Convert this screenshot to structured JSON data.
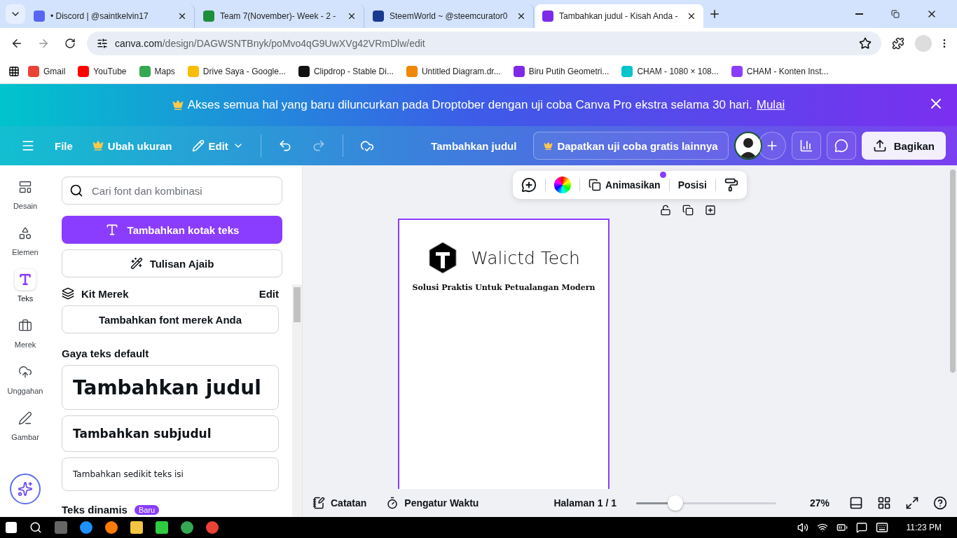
{
  "browser": {
    "tabs": [
      {
        "title": "• Discord | @saintkelvin17",
        "selected": false,
        "color": "#5865f2"
      },
      {
        "title": "Team 7(November)- Week - 2 -",
        "selected": false,
        "color": "#1e8e3e"
      },
      {
        "title": "SteemWorld ~ @steemcurator0",
        "selected": false,
        "color": "#1a3a8f"
      },
      {
        "title": "Tambahkan judul - Kisah Anda -",
        "selected": true,
        "color": "#7d2ae8"
      }
    ],
    "url_host": "canva.com",
    "url_path": "/design/DAGWSNTBnyk/poMvo4qG9UwXVg42VRmDlw/edit",
    "bookmarks": [
      {
        "label": "Gmail",
        "color": "#ea4335"
      },
      {
        "label": "YouTube",
        "color": "#ff0000"
      },
      {
        "label": "Maps",
        "color": "#34a853"
      },
      {
        "label": "Drive Saya - Google...",
        "color": "#fbbc04"
      },
      {
        "label": "Clipdrop - Stable Di...",
        "color": "#111111"
      },
      {
        "label": "Untitled Diagram.dr...",
        "color": "#f08705"
      },
      {
        "label": "Biru Putih Geometri...",
        "color": "#7d2ae8"
      },
      {
        "label": "CHAM - 1080 × 108...",
        "color": "#00c4cc"
      },
      {
        "label": "CHAM - Konten Inst...",
        "color": "#8b3dff"
      }
    ]
  },
  "banner": {
    "text": "Akses semua hal yang baru diluncurkan pada Droptober dengan uji coba Canva Pro ekstra selama 30 hari.",
    "link": "Mulai"
  },
  "toolbar": {
    "file": "File",
    "resize": "Ubah ukuran",
    "edit": "Edit",
    "title": "Tambahkan judul",
    "trial": "Dapatkan uji coba gratis lainnya",
    "share": "Bagikan"
  },
  "rail": [
    {
      "label": "Desain",
      "selected": false
    },
    {
      "label": "Elemen",
      "selected": false
    },
    {
      "label": "Teks",
      "selected": true
    },
    {
      "label": "Merek",
      "selected": false
    },
    {
      "label": "Unggahan",
      "selected": false
    },
    {
      "label": "Gambar",
      "selected": false
    }
  ],
  "panel": {
    "search_placeholder": "Cari font dan kombinasi",
    "add_text": "Tambahkan kotak teks",
    "magic_write": "Tulisan Ajaib",
    "brand_kit": {
      "title": "Kit Merek",
      "edit": "Edit",
      "button": "Tambahkan font merek Anda"
    },
    "default_styles": {
      "heading": "Gaya teks default",
      "items": [
        {
          "kind": "heading",
          "label": "Tambahkan judul"
        },
        {
          "kind": "subheading",
          "label": "Tambahkan subjudul"
        },
        {
          "kind": "body",
          "label": "Tambahkan sedikit teks isi"
        }
      ]
    },
    "dynamic": {
      "heading": "Teks dinamis",
      "badge": "Baru"
    }
  },
  "canvas": {
    "float_toolbar": {
      "animate": "Animasikan",
      "animate_new": true,
      "position": "Posisi"
    },
    "page": {
      "brand": "Walictd Tech",
      "tagline": "Solusi Praktis Untuk Petualangan Modern"
    }
  },
  "footer": {
    "notes": "Catatan",
    "timer": "Pengatur Waktu",
    "page_label": "Halaman 1 / 1",
    "zoom": {
      "level": 0.28,
      "reading": "27%"
    }
  },
  "taskbar": {
    "time": "11:23 PM"
  }
}
